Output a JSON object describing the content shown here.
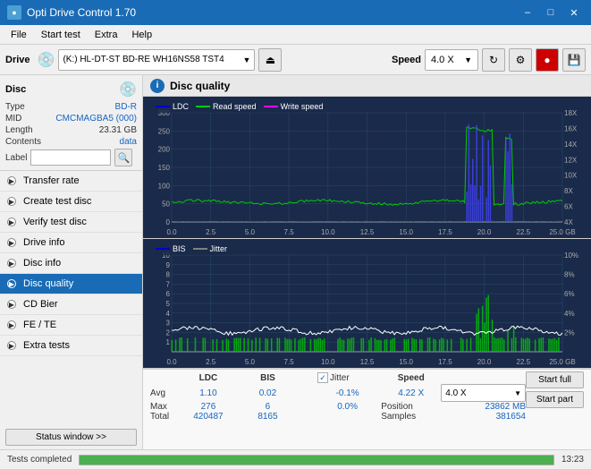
{
  "titlebar": {
    "title": "Opti Drive Control 1.70",
    "min": "–",
    "max": "□",
    "close": "✕"
  },
  "menubar": {
    "items": [
      "File",
      "Start test",
      "Extra",
      "Help"
    ]
  },
  "toolbar": {
    "drive_label": "Drive",
    "drive_value": "(K:)  HL-DT-ST BD-RE  WH16NS58 TST4",
    "speed_label": "Speed",
    "speed_value": "4.0 X"
  },
  "disc": {
    "title": "Disc",
    "type_label": "Type",
    "type_value": "BD-R",
    "mid_label": "MID",
    "mid_value": "CMCMAGBA5 (000)",
    "length_label": "Length",
    "length_value": "23.31 GB",
    "contents_label": "Contents",
    "contents_value": "data",
    "label_label": "Label",
    "label_value": ""
  },
  "nav": {
    "items": [
      {
        "id": "transfer-rate",
        "label": "Transfer rate",
        "active": false
      },
      {
        "id": "create-test-disc",
        "label": "Create test disc",
        "active": false
      },
      {
        "id": "verify-test-disc",
        "label": "Verify test disc",
        "active": false
      },
      {
        "id": "drive-info",
        "label": "Drive info",
        "active": false
      },
      {
        "id": "disc-info",
        "label": "Disc info",
        "active": false
      },
      {
        "id": "disc-quality",
        "label": "Disc quality",
        "active": true
      },
      {
        "id": "cd-bier",
        "label": "CD Bier",
        "active": false
      },
      {
        "id": "fe-te",
        "label": "FE / TE",
        "active": false
      },
      {
        "id": "extra-tests",
        "label": "Extra tests",
        "active": false
      }
    ],
    "status_window": "Status window >>"
  },
  "dq": {
    "title": "Disc quality",
    "legend1": [
      "LDC",
      "Read speed",
      "Write speed"
    ],
    "legend2": [
      "BIS",
      "Jitter"
    ],
    "chart1_ylabel_left": [
      "0",
      "50",
      "100",
      "150",
      "200",
      "250",
      "300"
    ],
    "chart1_ylabel_right": [
      "4X",
      "6X",
      "8X",
      "10X",
      "12X",
      "14X",
      "16X",
      "18X"
    ],
    "chart2_ylabel_left": [
      "1",
      "2",
      "3",
      "4",
      "5",
      "6",
      "7",
      "8",
      "9",
      "10"
    ],
    "chart2_ylabel_right": [
      "2%",
      "4%",
      "6%",
      "8%",
      "10%"
    ],
    "x_labels": [
      "0.0",
      "2.5",
      "5.0",
      "7.5",
      "10.0",
      "12.5",
      "15.0",
      "17.5",
      "20.0",
      "22.5",
      "25.0 GB"
    ]
  },
  "stats": {
    "headers": [
      "LDC",
      "BIS",
      "",
      "Jitter",
      "Speed",
      ""
    ],
    "avg": {
      "ldc": "1.10",
      "bis": "0.02",
      "jitter": "-0.1%",
      "speed": "4.22 X",
      "speed_dropdown": "4.0 X"
    },
    "max": {
      "ldc": "276",
      "bis": "6",
      "jitter": "0.0%",
      "position_label": "Position",
      "position_val": "23862 MB"
    },
    "total": {
      "ldc": "420487",
      "bis": "8165",
      "samples_label": "Samples",
      "samples_val": "381654"
    },
    "jitter_checked": true,
    "jitter_label": "Jitter",
    "row_labels": [
      "Avg",
      "Max",
      "Total"
    ],
    "start_full": "Start full",
    "start_part": "Start part"
  },
  "statusbar": {
    "text": "Tests completed",
    "progress": 100,
    "time": "13:23"
  }
}
